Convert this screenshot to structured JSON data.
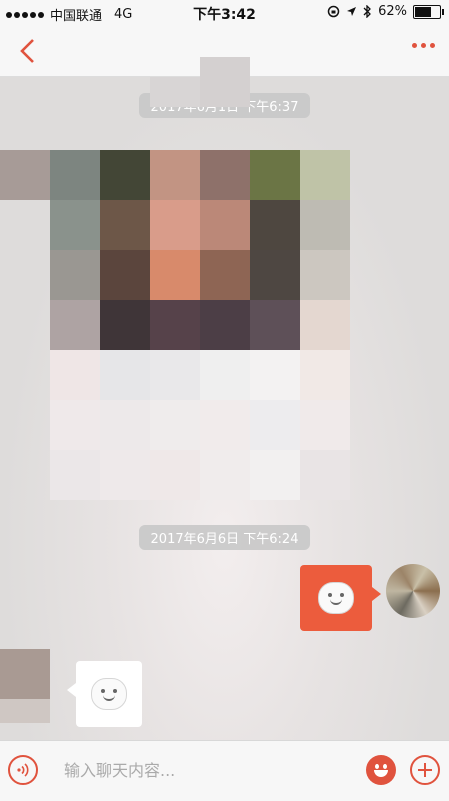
{
  "status_bar": {
    "carrier": "中国联通",
    "network": "4G",
    "time": "下午3:42",
    "battery": "62%",
    "battery_level": 0.62
  },
  "nav": {
    "back_icon": "chevron-left-icon",
    "more_icon": "ellipsis-icon",
    "accent_color": "#e0533e"
  },
  "chat": {
    "timestamps": [
      "2017年6月1日 下午6:37",
      "2017年6月6日 下午6:24"
    ],
    "messages": [
      {
        "side": "right",
        "content": "smiley-emoji-icon",
        "bubble_color": "#ec5c3d"
      },
      {
        "side": "left",
        "content": "smiley-emoji-icon",
        "bubble_color": "#ffffff"
      }
    ],
    "image_message": "pixelated-image"
  },
  "input_bar": {
    "placeholder": "输入聊天内容...",
    "voice_icon": "voice-icon",
    "emoji_icon": "emoji-icon",
    "plus_icon": "plus-icon"
  }
}
